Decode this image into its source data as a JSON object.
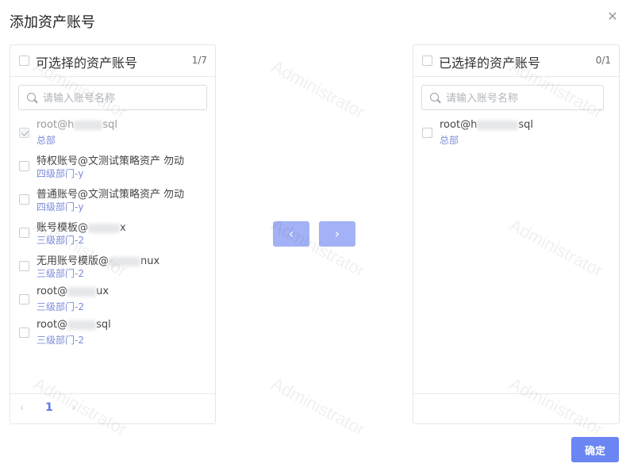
{
  "dialog": {
    "title": "添加资产账号",
    "close_icon": "close-icon",
    "confirm_label": "确定"
  },
  "watermark": "Administrator",
  "left_panel": {
    "title": "可选择的资产账号",
    "count": "1/7",
    "search_placeholder": "请输入账号名称",
    "items": [
      {
        "name_pre": "root@h",
        "name_post": "sql",
        "dept": "总部",
        "checked": true,
        "disabled": true
      },
      {
        "name_pre": "特权账号@文测试策略资产 勿动",
        "name_post": "",
        "dept": "四级部门-y",
        "checked": false,
        "disabled": false
      },
      {
        "name_pre": "普通账号@文测试策略资产 勿动",
        "name_post": "",
        "dept": "四级部门-y",
        "checked": false,
        "disabled": false
      },
      {
        "name_pre": "账号模板@",
        "name_post": "x",
        "dept": "三级部门-2",
        "checked": false,
        "disabled": false
      },
      {
        "name_pre": "无用账号模版@",
        "name_post": "nux",
        "dept": "三级部门-2",
        "checked": false,
        "disabled": false
      },
      {
        "name_pre": "root@",
        "name_post": "ux",
        "dept": "三级部门-2",
        "checked": false,
        "disabled": false
      },
      {
        "name_pre": "root@",
        "name_post": "sql",
        "dept": "三级部门-2",
        "checked": false,
        "disabled": false
      }
    ],
    "pagination": {
      "prev": "‹",
      "page": "1",
      "next": "›"
    }
  },
  "right_panel": {
    "title": "已选择的资产账号",
    "count": "0/1",
    "search_placeholder": "请输入账号名称",
    "items": [
      {
        "name_pre": "root@h",
        "name_post": "sql",
        "dept": "总部",
        "checked": false,
        "disabled": false
      }
    ]
  },
  "transfer": {
    "left_arrow": "‹",
    "right_arrow": "›"
  },
  "colors": {
    "primary": "#6b85f3",
    "transfer_disabled": "#a3b2f6",
    "dept_text": "#7b8bd9"
  }
}
